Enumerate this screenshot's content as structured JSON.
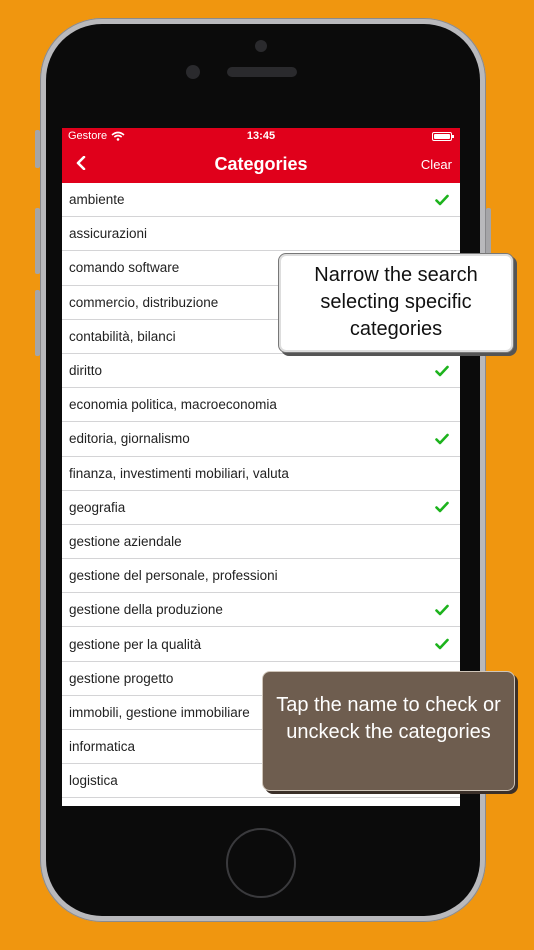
{
  "status_bar": {
    "carrier": "Gestore",
    "time": "13:45"
  },
  "nav": {
    "title": "Categories",
    "clear_label": "Clear"
  },
  "categories": [
    {
      "label": "ambiente",
      "checked": true
    },
    {
      "label": "assicurazioni",
      "checked": false
    },
    {
      "label": "comando software",
      "checked": false
    },
    {
      "label": "commercio, distribuzione",
      "checked": false
    },
    {
      "label": "contabilità, bilanci",
      "checked": false
    },
    {
      "label": "diritto",
      "checked": true
    },
    {
      "label": "economia politica, macroeconomia",
      "checked": false
    },
    {
      "label": "editoria, giornalismo",
      "checked": true
    },
    {
      "label": "finanza, investimenti mobiliari, valuta",
      "checked": false
    },
    {
      "label": "geografia",
      "checked": true
    },
    {
      "label": "gestione aziendale",
      "checked": false
    },
    {
      "label": "gestione del personale, professioni",
      "checked": false
    },
    {
      "label": "gestione della produzione",
      "checked": true
    },
    {
      "label": "gestione per la qualità",
      "checked": true
    },
    {
      "label": "gestione progetto",
      "checked": false
    },
    {
      "label": "immobili, gestione immobiliare",
      "checked": false
    },
    {
      "label": "informatica",
      "checked": false
    },
    {
      "label": "logistica",
      "checked": false
    }
  ],
  "callouts": {
    "top": "Narrow the search selecting specific categories",
    "bottom": "Tap the name to check or unckeck the categories"
  },
  "colors": {
    "background": "#f0960f",
    "accent_red": "#e0001b",
    "check_green": "#1db31d",
    "callout_dark": "#6e5d4f"
  },
  "icons": {
    "back": "chevron-left-icon",
    "wifi": "wifi-icon",
    "battery": "battery-icon",
    "check": "checkmark-icon"
  }
}
